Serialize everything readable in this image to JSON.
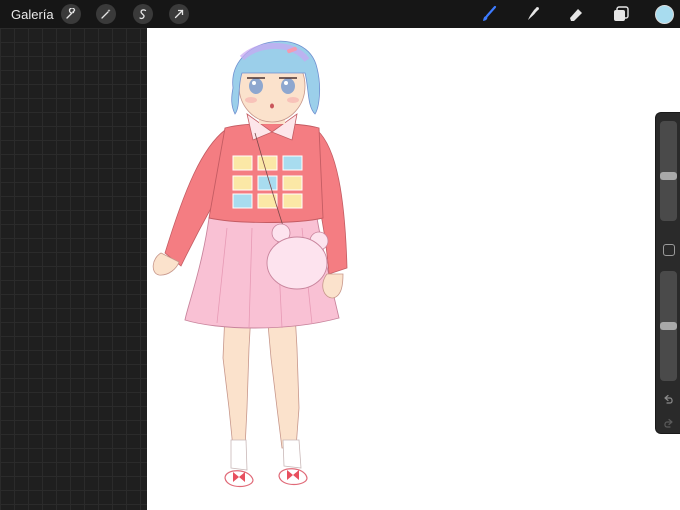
{
  "topbar": {
    "gallery_label": "Galería",
    "left_tools": [
      "wrench-icon",
      "magic-wand-icon",
      "selection-icon",
      "transform-arrow-icon"
    ],
    "right_tools": [
      "brush-icon",
      "smudge-icon",
      "eraser-icon",
      "layers-icon"
    ],
    "active_tool": "brush-icon",
    "current_color": "#a8dcef"
  },
  "sidebar": {
    "brush_size_level": 0.45,
    "opacity_level": 0.5
  },
  "colors": {
    "brush_active": "#3d7bff",
    "canvas": "#ffffff"
  }
}
